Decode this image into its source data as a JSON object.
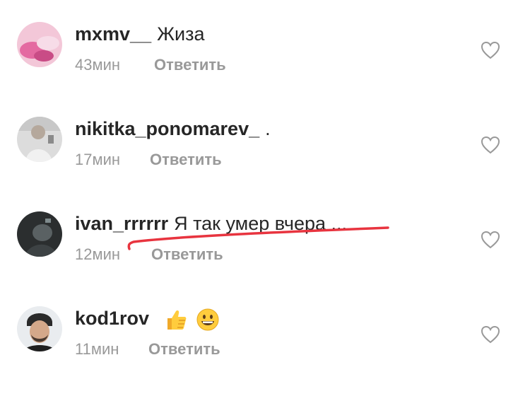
{
  "comments": [
    {
      "username": "mxmv__",
      "text": "Жиза",
      "time": "43мин",
      "reply": "Ответить"
    },
    {
      "username": "nikitka_ponomarev_",
      "text": ".",
      "time": "17мин",
      "reply": "Ответить"
    },
    {
      "username": "ivan_rrrrrr",
      "text": "Я так умер вчера ...",
      "time": "12мин",
      "reply": "Ответить"
    },
    {
      "username": "kod1rov",
      "text": "",
      "time": "11мин",
      "reply": "Ответить"
    }
  ],
  "icons": {
    "like": "heart-outline-icon",
    "emoji_1": "thumbs-up-emoji",
    "emoji_2": "grinning-face-emoji"
  },
  "colors": {
    "text": "#262626",
    "meta": "#999999",
    "annotation": "#e8343f"
  }
}
